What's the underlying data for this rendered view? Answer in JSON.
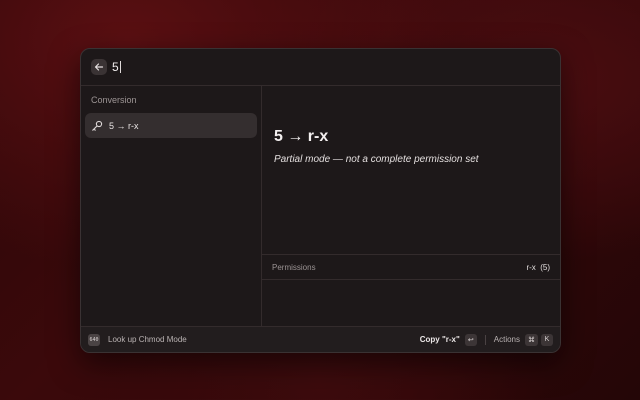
{
  "search": {
    "query": "5"
  },
  "list": {
    "section_title": "Conversion",
    "items": [
      {
        "label": "5 → r-x"
      }
    ]
  },
  "detail": {
    "title": "5 → r-x",
    "subtitle": "Partial mode — not a complete permission set",
    "metadata": [
      {
        "label": "Permissions",
        "value": "r-x  (5)"
      }
    ]
  },
  "footer": {
    "app_icon_text": "640",
    "title": "Look up Chmod Mode",
    "primary_action": "Copy \"r-x\"",
    "primary_key": "↩",
    "actions_label": "Actions",
    "actions_keys": [
      "⌘",
      "K"
    ]
  },
  "colors": {
    "background": "#3b090b",
    "window": "#1d1819",
    "selected": "#342e2f"
  }
}
